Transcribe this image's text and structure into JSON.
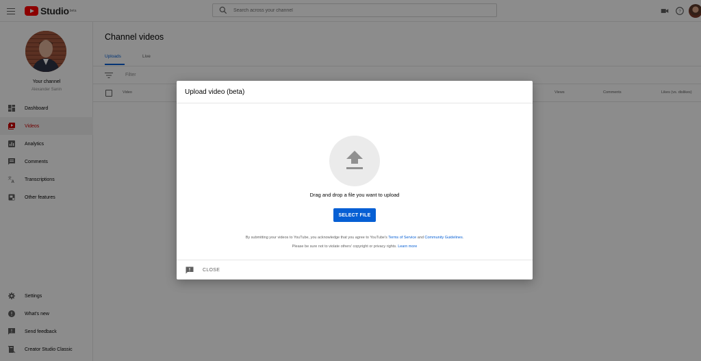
{
  "app": {
    "logo_text": "Studio",
    "logo_beta": "beta"
  },
  "search": {
    "placeholder": "Search across your channel"
  },
  "sidebar": {
    "channel_name": "Your channel",
    "channel_owner": "Alexander Sanin",
    "items": [
      {
        "label": "Dashboard",
        "icon": "dashboard-icon"
      },
      {
        "label": "Videos",
        "icon": "videos-icon",
        "active": true
      },
      {
        "label": "Analytics",
        "icon": "analytics-icon"
      },
      {
        "label": "Comments",
        "icon": "comments-icon"
      },
      {
        "label": "Transcriptions",
        "icon": "transcriptions-icon"
      },
      {
        "label": "Other features",
        "icon": "other-features-icon"
      }
    ],
    "bottom_items": [
      {
        "label": "Settings",
        "icon": "gear-icon"
      },
      {
        "label": "What's new",
        "icon": "whats-new-icon"
      },
      {
        "label": "Send feedback",
        "icon": "feedback-icon"
      },
      {
        "label": "Creator Studio Classic",
        "icon": "classic-studio-icon"
      }
    ]
  },
  "main": {
    "title": "Channel videos",
    "tabs": [
      {
        "label": "Uploads",
        "active": true
      },
      {
        "label": "Live"
      }
    ],
    "filter_label": "Filter",
    "columns": [
      "Video",
      "Views",
      "Comments",
      "Likes (vs. dislikes)"
    ]
  },
  "dialog": {
    "title": "Upload video (beta)",
    "drag_text": "Drag and drop a file you want to upload",
    "select_button": "SELECT FILE",
    "legal_line1_prefix": "By submitting your videos to YouTube, you acknowledge that you agree to YouTube's ",
    "terms_link": "Terms of Service",
    "legal_and": " and ",
    "guidelines_link": "Community Guidelines",
    "legal_line1_suffix": ".",
    "legal_line2_prefix": "Please be sure not to violate others' copyright or privacy rights. ",
    "learn_more_link": "Learn more",
    "close_button": "CLOSE"
  },
  "colors": {
    "brand_red": "#ff0000",
    "accent_blue": "#065fd4",
    "active_nav_red": "#cc0000"
  }
}
